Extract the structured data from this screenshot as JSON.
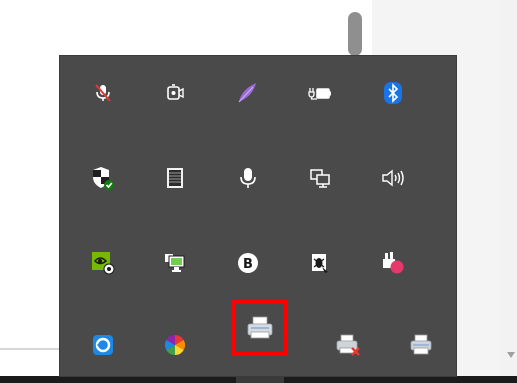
{
  "tray_overflow": {
    "rows": [
      [
        {
          "name": "microphone-muted-icon"
        },
        {
          "name": "camera-in-use-icon"
        },
        {
          "name": "feather-icon"
        },
        {
          "name": "battery-power-icon"
        },
        {
          "name": "bluetooth-icon"
        }
      ],
      [
        {
          "name": "windows-security-icon"
        },
        {
          "name": "keyboard-input-icon"
        },
        {
          "name": "microphone-icon"
        },
        {
          "name": "network-wired-icon"
        },
        {
          "name": "speaker-volume-icon"
        }
      ],
      [
        {
          "name": "nvidia-icon"
        },
        {
          "name": "display-settings-icon"
        },
        {
          "name": "b-app-icon"
        },
        {
          "name": "bug-tool-icon"
        },
        {
          "name": "paint-app-icon"
        }
      ],
      [
        {
          "name": "sync-ring-icon"
        },
        {
          "name": "color-wheel-icon"
        },
        {
          "name": "printer-icon",
          "highlighted": true
        },
        {
          "name": "network-printer-error-icon"
        },
        {
          "name": "printer-device-icon"
        }
      ]
    ],
    "colors": {
      "panel": "#4a4a4a",
      "highlight": "#ff0000",
      "bluetooth": "#1a73e8",
      "nvidia": "#76b900",
      "sync": "#1e88e5"
    },
    "b_app_letter": "B"
  }
}
